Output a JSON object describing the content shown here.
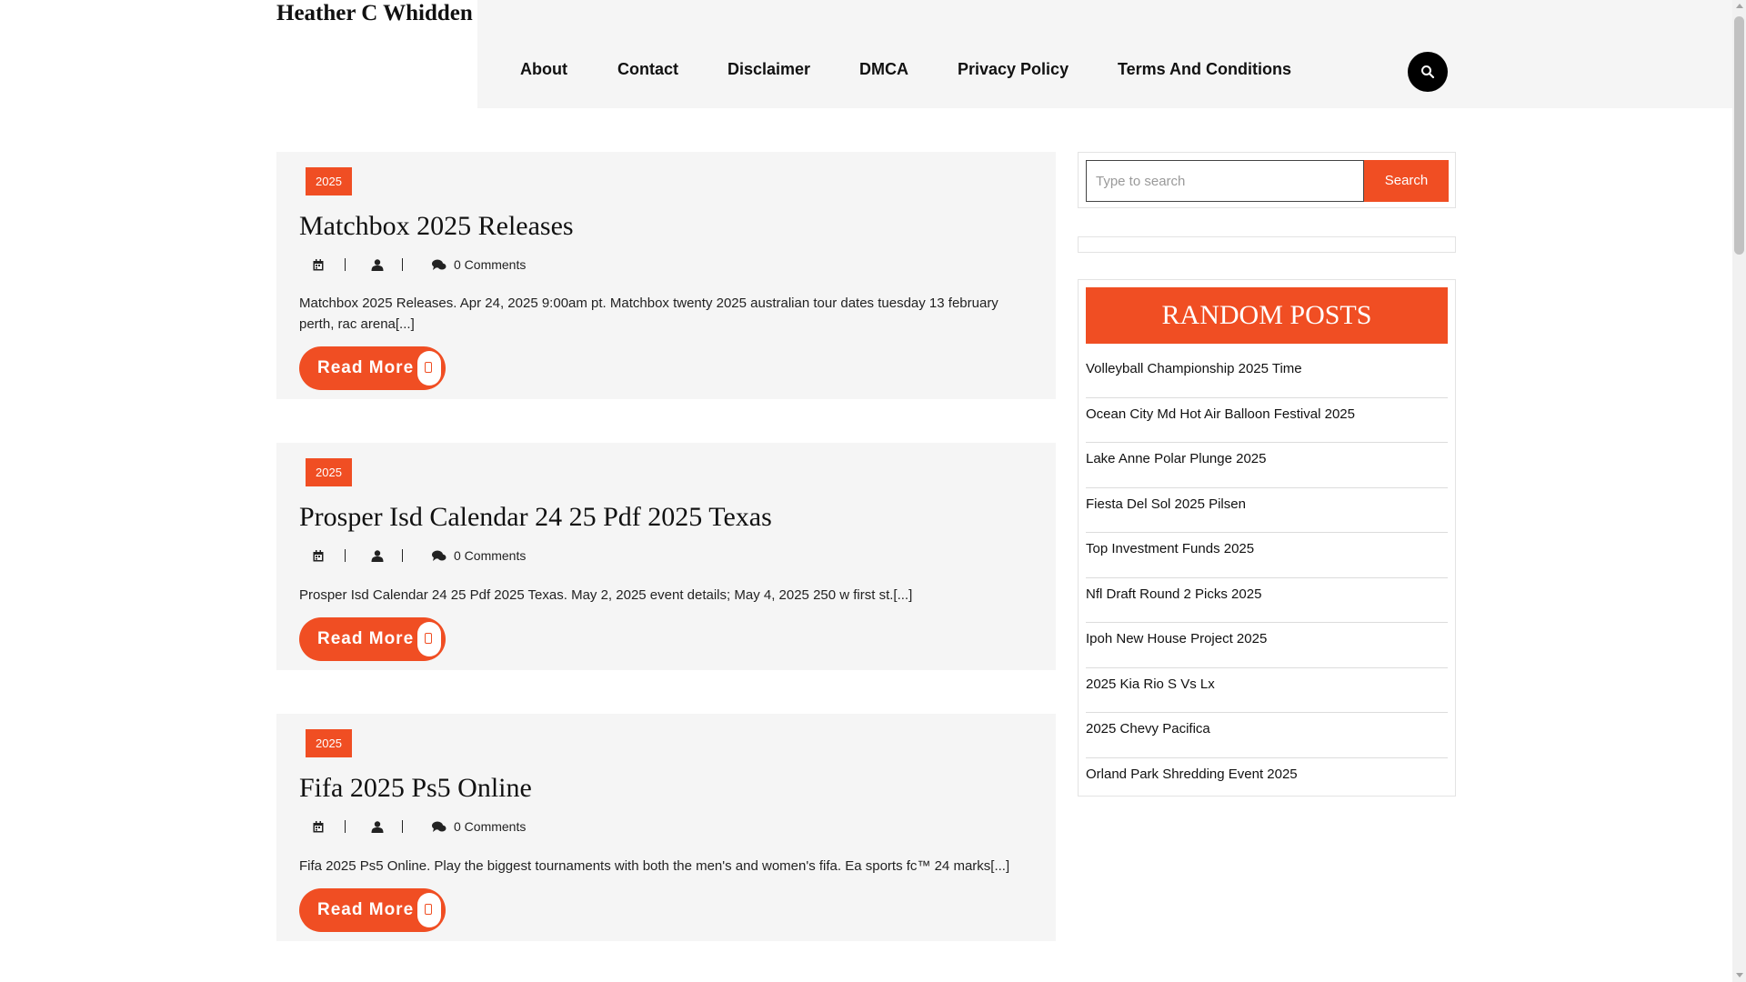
{
  "site": {
    "title": "Heather C Whidden"
  },
  "nav": {
    "items": [
      "About",
      "Contact",
      "Disclaimer",
      "DMCA",
      "Privacy Policy",
      "Terms And Conditions"
    ],
    "search_icon": "search-icon"
  },
  "posts": [
    {
      "category": "2025",
      "title": "Matchbox 2025 Releases",
      "comments": "0 Comments",
      "excerpt": "Matchbox 2025 Releases. Apr 24, 2025 9:00am pt. Matchbox twenty 2025 australian tour dates tuesday 13 february perth, rac arena[...]",
      "read_more": "Read More"
    },
    {
      "category": "2025",
      "title": "Prosper Isd Calendar 24 25 Pdf 2025 Texas",
      "comments": "0 Comments",
      "excerpt": "Prosper Isd Calendar 24 25 Pdf 2025 Texas. May 2, 2025 event details; May 4, 2025 250 w first st.[...]",
      "read_more": "Read More"
    },
    {
      "category": "2025",
      "title": "Fifa 2025 Ps5 Online",
      "comments": "0 Comments",
      "excerpt": "Fifa 2025 Ps5 Online. Play the biggest tournaments with both the men's and women's fifa. Ea sports fc™ 24 marks[...]",
      "read_more": "Read More"
    }
  ],
  "sidebar": {
    "search": {
      "placeholder": "Type to search",
      "button": "Search"
    },
    "random_posts": {
      "title": "RANDOM POSTS",
      "items": [
        "Volleyball Championship 2025 Time",
        "Ocean City Md Hot Air Balloon Festival 2025",
        "Lake Anne Polar Plunge 2025",
        "Fiesta Del Sol 2025 Pilsen",
        "Top Investment Funds 2025",
        "Nfl Draft Round 2 Picks 2025",
        "Ipoh New House Project 2025",
        "2025 Kia Rio S Vs Lx",
        "2025 Chevy Pacifica",
        "Orland Park Shredding Event 2025"
      ]
    }
  },
  "colors": {
    "accent": "#f04e23",
    "panel": "#f5f5f5"
  }
}
